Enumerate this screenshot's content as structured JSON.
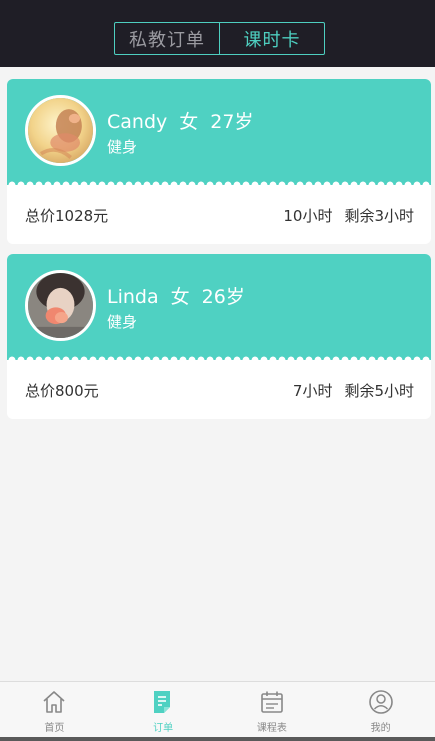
{
  "header": {
    "tabs": [
      {
        "label": "私教订单",
        "active": false
      },
      {
        "label": "课时卡",
        "active": true
      }
    ]
  },
  "cards": [
    {
      "name": "Candy",
      "gender": "女",
      "age": "27岁",
      "category": "健身",
      "price": "总价1028元",
      "hours": "10小时",
      "remaining": "剩余3小时"
    },
    {
      "name": "Linda",
      "gender": "女",
      "age": "26岁",
      "category": "健身",
      "price": "总价800元",
      "hours": "7小时",
      "remaining": "剩余5小时"
    }
  ],
  "tabbar": {
    "items": [
      {
        "label": "首页",
        "icon": "home-icon",
        "active": false
      },
      {
        "label": "订单",
        "icon": "order-icon",
        "active": true
      },
      {
        "label": "课程表",
        "icon": "calendar-icon",
        "active": false
      },
      {
        "label": "我的",
        "icon": "profile-icon",
        "active": false
      }
    ]
  },
  "colors": {
    "accent": "#4fd1c2",
    "topbar": "#1f1e26",
    "background": "#f4f4f4"
  }
}
